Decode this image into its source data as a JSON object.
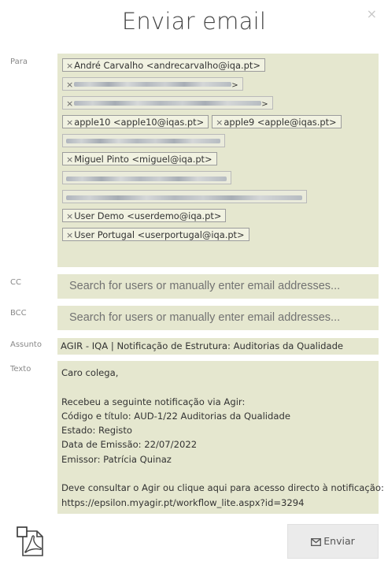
{
  "dialog": {
    "title": "Enviar email",
    "close_glyph": "×"
  },
  "labels": {
    "to": "Para",
    "cc": "CC",
    "bcc": "BCC",
    "subject": "Assunto",
    "text": "Texto"
  },
  "tag_remove_glyph": "×",
  "recipients": {
    "andre": "André Carvalho <andrecarvalho@iqa.pt>",
    "apple10": "apple10 <apple10@iqas.pt>",
    "apple9": "apple9 <apple@iqas.pt>",
    "miguel": "Miguel Pinto <miguel@iqa.pt>",
    "userdemo": "User Demo <userdemo@iqa.pt>",
    "userportugal": "User Portugal <userportugal@iqa.pt>"
  },
  "cc": {
    "placeholder": "Search for users or manually enter email addresses..."
  },
  "bcc": {
    "placeholder": "Search for users or manually enter email addresses..."
  },
  "subject": {
    "value": "AGIR - IQA | Notificação de Estrutura: Auditorias da Qualidade"
  },
  "body": {
    "line1": "Caro colega,",
    "line2": "",
    "line3": "Recebeu a seguinte notificação via Agir:",
    "line4": "Código e título: AUD-1/22 Auditorias da Qualidade",
    "line5": "Estado: Registo",
    "line6": "Data de Emissão: 22/07/2022",
    "line7": "Emissor: Patrícia Quinaz",
    "line8": "",
    "line9": "Deve consultar o Agir ou clique aqui para acesso directo à notificação:",
    "line10": "https://epsilon.myagir.pt/workflow_lite.aspx?id=3294"
  },
  "actions": {
    "send_label": "Enviar"
  },
  "icons": {
    "close": "close-icon",
    "tag_remove": "remove-icon",
    "pdf": "pdf-icon",
    "send": "envelope-icon"
  }
}
